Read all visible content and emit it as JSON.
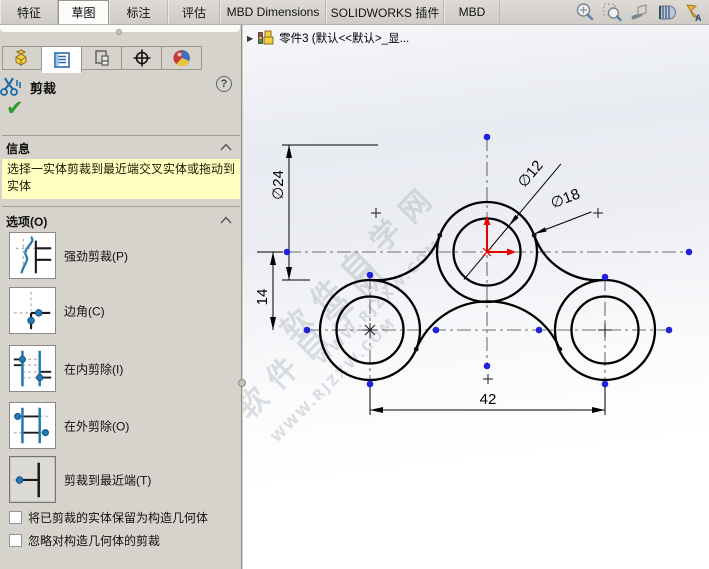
{
  "ribbon": {
    "tabs": [
      {
        "label": "特征",
        "active": false
      },
      {
        "label": "草图",
        "active": true
      },
      {
        "label": "标注",
        "active": false
      },
      {
        "label": "评估",
        "active": false
      },
      {
        "label": "MBD Dimensions",
        "active": false
      },
      {
        "label": "SOLIDWORKS 插件",
        "active": false
      },
      {
        "label": "MBD",
        "active": false
      }
    ],
    "heads_up_icons": [
      "zoom-to-fit",
      "zoom-to-area",
      "previous-view",
      "section-view",
      "edit-appearance"
    ]
  },
  "property_manager": {
    "tabs": [
      "feature-manager-design-tree",
      "property-manager",
      "configuration-manager",
      "dimxpert-manager",
      "display-manager"
    ],
    "active_tab": "property-manager",
    "title": "剪裁",
    "help_label": "?",
    "ok_label": "✔",
    "info": {
      "header": "信息",
      "message": "选择一实体剪裁到最近端交叉实体或拖动到实体"
    },
    "options": {
      "header": "选项(O)",
      "items": [
        {
          "label": "强劲剪裁(P)",
          "selected": false
        },
        {
          "label": "边角(C)",
          "selected": false
        },
        {
          "label": "在内剪除(I)",
          "selected": false
        },
        {
          "label": "在外剪除(O)",
          "selected": false
        },
        {
          "label": "剪裁到最近端(T)",
          "selected": true
        }
      ],
      "checkboxes": [
        {
          "label": "将已剪裁的实体保留为构造几何体",
          "checked": false
        },
        {
          "label": "忽略对构造几何体的剪裁",
          "checked": false
        }
      ]
    }
  },
  "canvas": {
    "tree_item": "零件3 (默认<<默认>_显...",
    "watermark": {
      "line1": "软件自学网",
      "line2": "WWW.RJZXW.COM"
    },
    "dimensions": {
      "d24": "∅24",
      "d14": "14",
      "d12": "∅12",
      "d18": "∅18",
      "d42": "42"
    },
    "sketch": {
      "outer_circle_diameter": "18",
      "inner_circle_diameter": "12",
      "center_distance_horizontal": "42",
      "center_distance_vertical": "14",
      "fillet_diameter": "24"
    },
    "colors": {
      "sketch_line": "#000000",
      "centerline": "#6e6e6e",
      "sketch_point": "#2121dd",
      "origin": "#e80000",
      "message_bg": "#ffffc2",
      "icon_blue": "#2279b5"
    }
  }
}
